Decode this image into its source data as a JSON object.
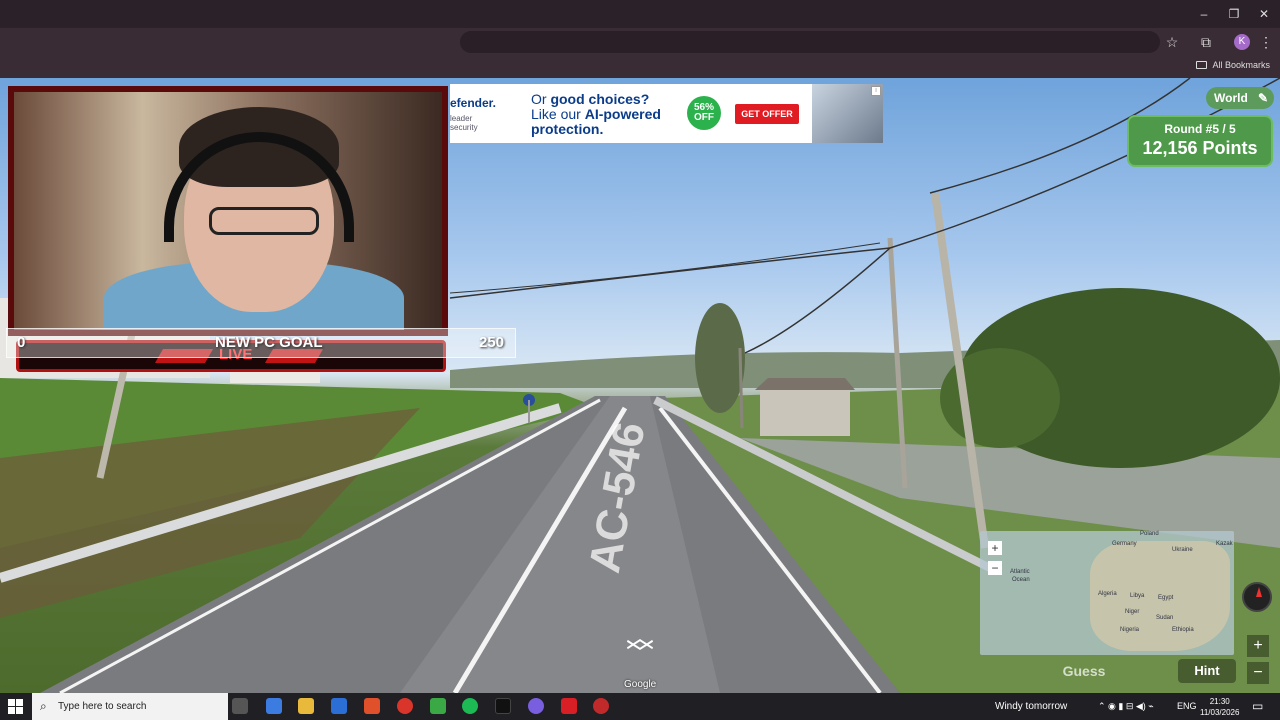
{
  "browser": {
    "bookmarks_label": "All Bookmarks",
    "profile_initial": "K",
    "window_controls": [
      "–",
      "❐",
      "✕"
    ]
  },
  "ad": {
    "brand": "efender.",
    "sub": "leader\nsecurity",
    "line1_pre": "Or ",
    "line1_bold": "good choices?",
    "line2_pre": "Like our ",
    "line2_bold": "AI-powered",
    "line3": "protection.",
    "badge": "56%\nOFF",
    "cta": "GET OFFER"
  },
  "webcam": {
    "live_label": "LIVE"
  },
  "goal": {
    "current": "0",
    "title": "NEW PC GOAL",
    "target": "250"
  },
  "game": {
    "map_name": "World",
    "round_label": "Round #5 / 5",
    "points": "12,156 Points",
    "guess_label": "Guess",
    "hint_label": "Hint",
    "road_sign": "AC-546",
    "attribution": "Google",
    "minimap_labels": [
      "Poland",
      "Germany",
      "Ukraine",
      "Kazak",
      "Atlantic",
      "Ocean",
      "Algeria",
      "Libya",
      "Egypt",
      "Niger",
      "Sudan",
      "Nigeria",
      "Ethiopia"
    ],
    "zoom_plus": "+",
    "zoom_minus": "−"
  },
  "taskbar": {
    "search_placeholder": "Type here to search",
    "weather": "Windy tomorrow",
    "language": "ENG",
    "time": "21:30",
    "date": "11/03/2026"
  }
}
